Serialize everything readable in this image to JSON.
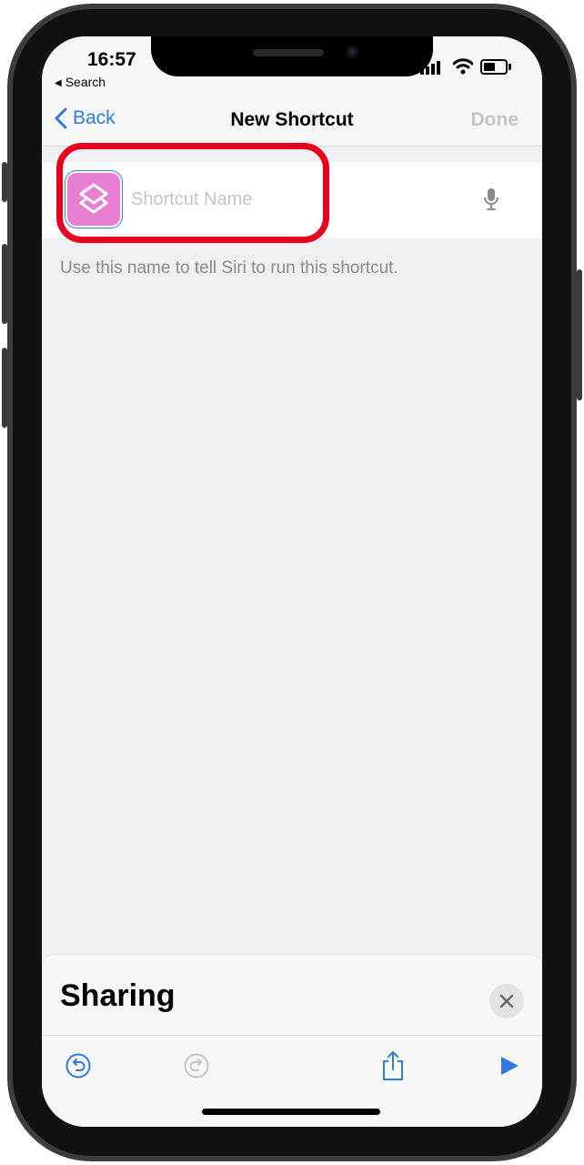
{
  "status_bar": {
    "time": "16:57",
    "back_app": "Search"
  },
  "nav": {
    "back_label": "Back",
    "title": "New Shortcut",
    "done_label": "Done"
  },
  "shortcut": {
    "name_value": "",
    "name_placeholder": "Shortcut Name",
    "icon": "layers-icon",
    "icon_color": "#e97fd2",
    "hint": "Use this name to tell Siri to run this shortcut."
  },
  "sheet": {
    "title": "Sharing"
  },
  "toolbar": {
    "items": [
      "undo-icon",
      "redo-icon",
      "share-icon",
      "play-icon"
    ]
  },
  "colors": {
    "accent": "#2d7be3",
    "highlight": "#e8001c"
  }
}
